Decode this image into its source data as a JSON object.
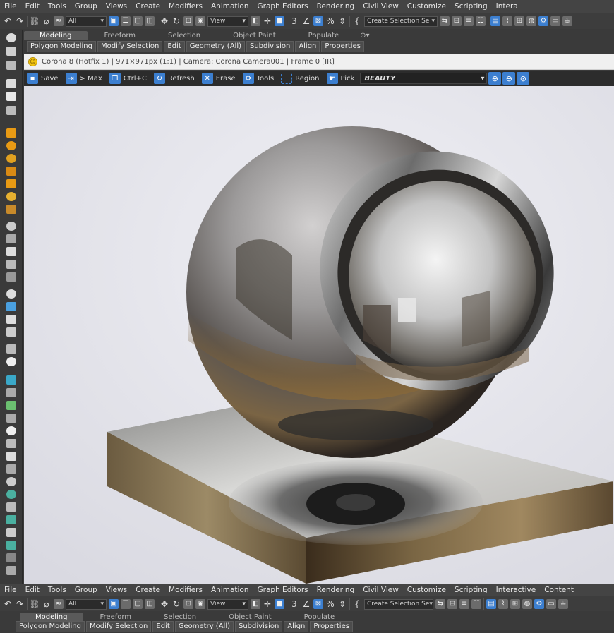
{
  "menu": [
    "File",
    "Edit",
    "Tools",
    "Group",
    "Views",
    "Create",
    "Modifiers",
    "Animation",
    "Graph Editors",
    "Rendering",
    "Civil View",
    "Customize",
    "Scripting",
    "Interactive",
    "Content"
  ],
  "menu_top": [
    "File",
    "Edit",
    "Tools",
    "Group",
    "Views",
    "Create",
    "Modifiers",
    "Animation",
    "Graph Editors",
    "Rendering",
    "Civil View",
    "Customize",
    "Scripting",
    "Intera"
  ],
  "toolbar": {
    "filter": "All",
    "view": "View",
    "selection_set": "Create Selection Se"
  },
  "ribbon": {
    "tabs": [
      "Modeling",
      "Freeform",
      "Selection",
      "Object Paint",
      "Populate"
    ],
    "active_tab": "Modeling",
    "panels": [
      "Polygon Modeling",
      "Modify Selection",
      "Edit",
      "Geometry (All)",
      "Subdivision",
      "Align",
      "Properties"
    ]
  },
  "vfb": {
    "title": "Corona 8 (Hotfix 1) | 971×971px (1:1) | Camera: Corona Camera001 | Frame 0 [IR]",
    "buttons": [
      {
        "icon": "save-icon",
        "label": "Save"
      },
      {
        "icon": "max-icon",
        "label": "> Max"
      },
      {
        "icon": "copy-icon",
        "label": "Ctrl+C"
      },
      {
        "icon": "refresh-icon",
        "label": "Refresh"
      },
      {
        "icon": "erase-icon",
        "label": "Erase"
      },
      {
        "icon": "tools-icon",
        "label": "Tools"
      },
      {
        "icon": "region-icon",
        "label": "Region"
      },
      {
        "icon": "pick-icon",
        "label": "Pick"
      }
    ],
    "channel": "BEAUTY"
  }
}
